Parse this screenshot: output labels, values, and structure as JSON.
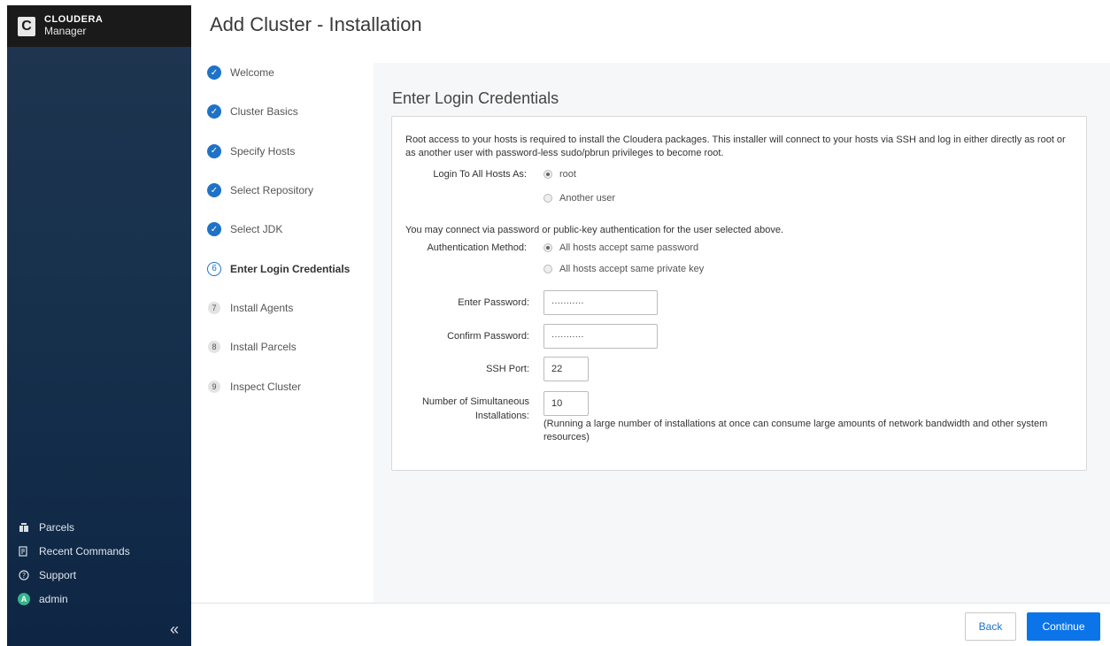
{
  "brand": {
    "name": "CLOUDERA",
    "sub": "Manager",
    "logo_letter": "C"
  },
  "page_title": "Add Cluster - Installation",
  "steps": [
    {
      "label": "Welcome",
      "state": "done"
    },
    {
      "label": "Cluster Basics",
      "state": "done"
    },
    {
      "label": "Specify Hosts",
      "state": "done"
    },
    {
      "label": "Select Repository",
      "state": "done"
    },
    {
      "label": "Select JDK",
      "state": "done"
    },
    {
      "label": "Enter Login Credentials",
      "state": "active",
      "number": "6"
    },
    {
      "label": "Install Agents",
      "state": "pending",
      "number": "7"
    },
    {
      "label": "Install Parcels",
      "state": "pending",
      "number": "8"
    },
    {
      "label": "Inspect Cluster",
      "state": "pending",
      "number": "9"
    }
  ],
  "sidebar": {
    "links": [
      {
        "label": "Parcels",
        "icon": "parcels-icon"
      },
      {
        "label": "Recent Commands",
        "icon": "commands-icon"
      },
      {
        "label": "Support",
        "icon": "help-icon"
      },
      {
        "label": "admin",
        "icon": "avatar",
        "avatar_letter": "A"
      }
    ],
    "collapse_glyph": "«"
  },
  "main": {
    "title": "Enter Login Credentials",
    "intro": "Root access to your hosts is required to install the Cloudera packages. This installer will connect to your hosts via SSH and log in either directly as root or as another user with password-less sudo/pbrun privileges to become root.",
    "login_label": "Login To All Hosts As:",
    "login_options": [
      "root",
      "Another user"
    ],
    "auth_text": "You may connect via password or public-key authentication for the user selected above.",
    "auth_label": "Authentication Method:",
    "auth_options": [
      "All hosts accept same password",
      "All hosts accept same private key"
    ],
    "enter_password_label": "Enter Password:",
    "enter_password_value": "···········",
    "confirm_password_label": "Confirm Password:",
    "confirm_password_value": "···········",
    "ssh_port_label": "SSH Port:",
    "ssh_port_value": "22",
    "simul_label_1": "Number of Simultaneous",
    "simul_label_2": "Installations:",
    "simul_value": "10",
    "simul_note": "(Running a large number of installations at once can consume large amounts of network bandwidth and other system resources)"
  },
  "footer": {
    "back_label": "Back",
    "continue_label": "Continue"
  },
  "colors": {
    "accent": "#0a74e8",
    "step_done": "#1f72c6",
    "sidebar_dark": "#16304c"
  }
}
